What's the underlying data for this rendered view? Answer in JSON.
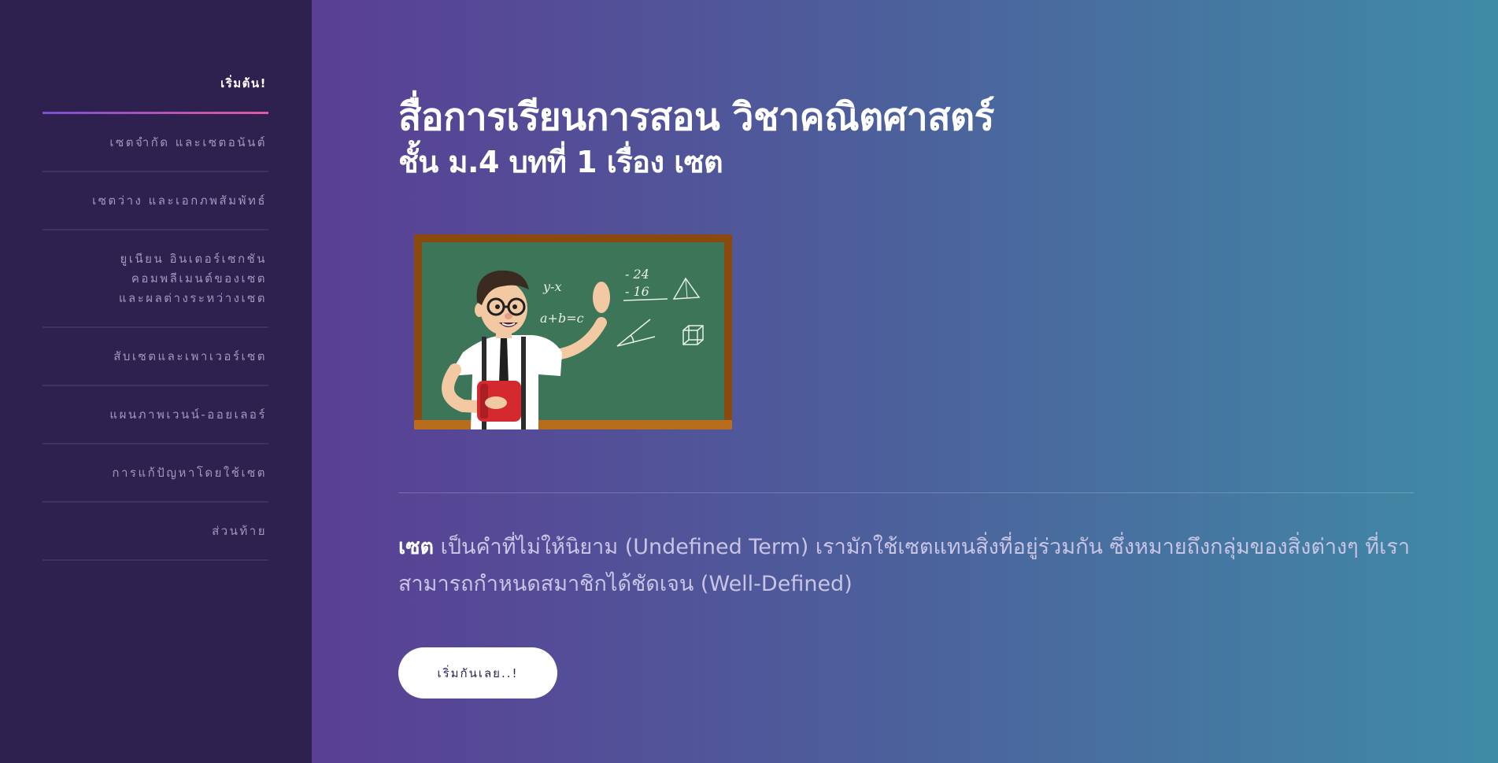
{
  "sidebar": {
    "items": [
      {
        "lines": [
          "เริ่มต้น!"
        ],
        "active": true
      },
      {
        "lines": [
          "เซตจำกัด และเซตอนันต์"
        ],
        "active": false
      },
      {
        "lines": [
          "เซตว่าง และเอกภพสัมพัทธ์"
        ],
        "active": false
      },
      {
        "lines": [
          "ยูเนียน อินเตอร์เซกชัน",
          "คอมพลีเมนต์ของเซต",
          "และผลต่างระหว่างเซต"
        ],
        "active": false
      },
      {
        "lines": [
          "สับเซตและเพาเวอร์เซต"
        ],
        "active": false
      },
      {
        "lines": [
          "แผนภาพเวนน์-ออยเลอร์"
        ],
        "active": false
      },
      {
        "lines": [
          "การแก้ปัญหาโดยใช้เซต"
        ],
        "active": false
      },
      {
        "lines": [
          "ส่วนท้าย"
        ],
        "active": false
      }
    ]
  },
  "main": {
    "title": "สื่อการเรียนการสอน วิชาคณิตศาสตร์",
    "subtitle": "ชั้น ม.4 บทที่ 1 เรื่อง เซต",
    "illustration": {
      "board_text": [
        "y-x",
        "- 24",
        "- 16",
        "a+b=c"
      ]
    },
    "description": {
      "term": "เซต",
      "text": " เป็นคำที่ไม่ให้นิยาม (Undefined Term) เรามักใช้เซตแทนสิ่งที่อยู่ร่วมกัน ซึ่งหมายถึงกลุ่มของสิ่งต่างๆ ที่เราสามารถกำหนดสมาชิกได้ชัดเจน (Well-Defined)"
    },
    "start_button_label": "เริ่มกันเลย..!"
  },
  "colors": {
    "sidebar_bg": "#2e2150",
    "gradient_start": "#5a3f94",
    "gradient_end": "#3f8ba6",
    "active_underline": "#e05a9e"
  }
}
